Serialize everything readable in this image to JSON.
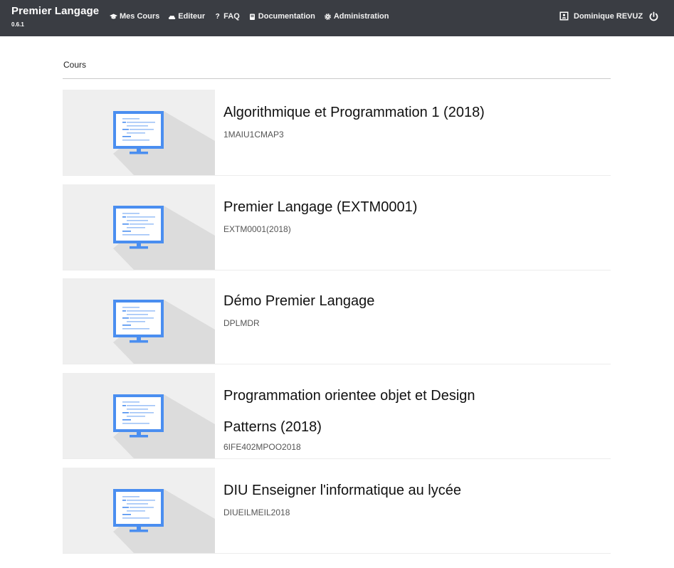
{
  "navbar": {
    "brand": "Premier Langage",
    "version": "0.6.1",
    "links": [
      {
        "label": "Mes Cours",
        "icon": "graduation-cap-icon"
      },
      {
        "label": "Editeur",
        "icon": "cloud-icon"
      },
      {
        "label": "FAQ",
        "icon": "question-icon"
      },
      {
        "label": "Documentation",
        "icon": "book-icon"
      },
      {
        "label": "Administration",
        "icon": "gear-icon"
      }
    ],
    "user": {
      "name": "Dominique REVUZ",
      "icon": "user-card-icon"
    },
    "logout_icon": "power-icon"
  },
  "main": {
    "section_title": "Cours",
    "courses": [
      {
        "title": "Algorithmique et Programmation 1 (2018)",
        "code": "1MAIU1CMAP3",
        "icon": "monitor-code-icon"
      },
      {
        "title": "Premier Langage (EXTM0001)",
        "code": "EXTM0001(2018)",
        "icon": "monitor-code-icon"
      },
      {
        "title": "Démo Premier Langage",
        "code": "DPLMDR",
        "icon": "monitor-code-icon"
      },
      {
        "title": "Programmation orientee objet et Design Patterns (2018)",
        "code": "6IFE402MPOO2018",
        "icon": "monitor-code-icon"
      },
      {
        "title": "DIU Enseigner l'informatique au lycée",
        "code": "DIUEILMEIL2018",
        "icon": "monitor-code-icon"
      }
    ]
  },
  "colors": {
    "navbar_bg": "#3a3d43",
    "monitor_blue": "#4a8ef0",
    "thumb_bg": "#efefef",
    "thumb_shadow": "#dcdcdc"
  }
}
